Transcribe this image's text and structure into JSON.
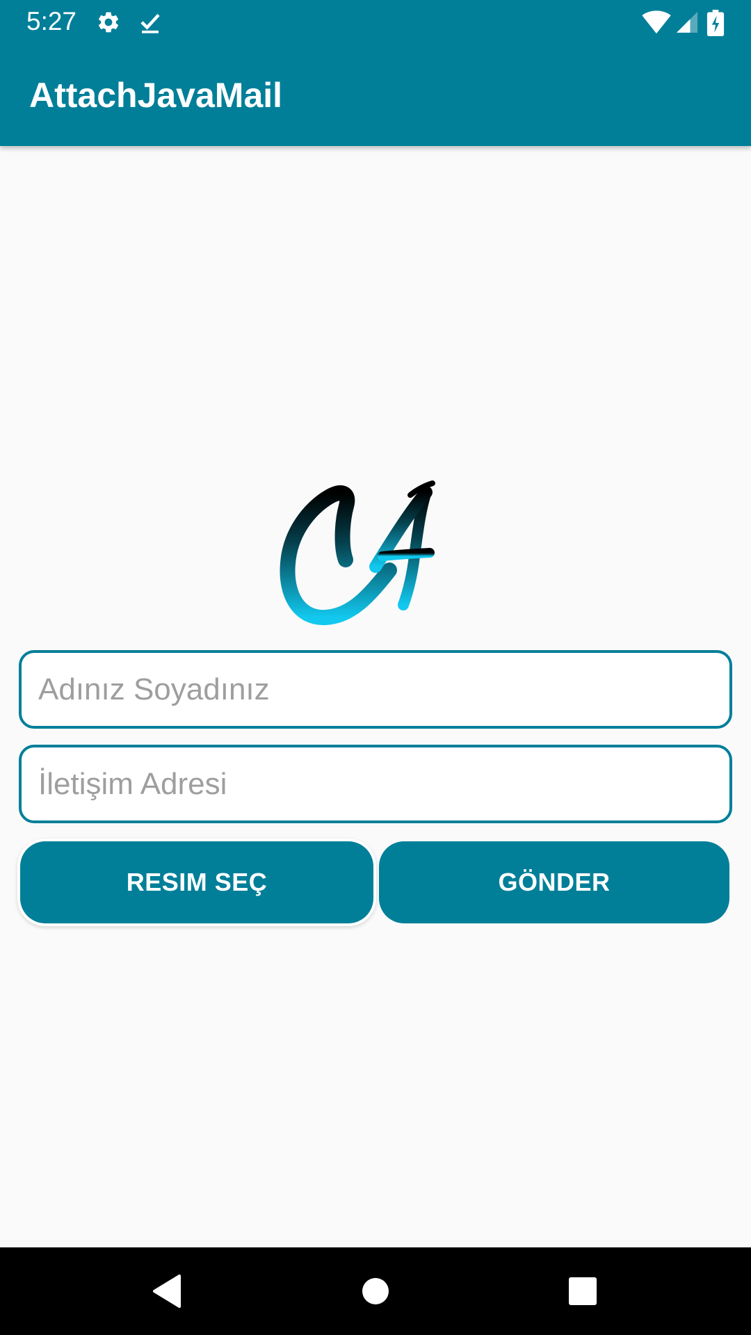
{
  "status_bar": {
    "time": "5:27",
    "icons": [
      "gear-icon",
      "check-download-icon",
      "wifi-icon",
      "signal-icon",
      "battery-charging-icon"
    ]
  },
  "app_bar": {
    "title": "AttachJavaMail"
  },
  "logo": {
    "text": "CA",
    "gradient_top": "#000000",
    "gradient_bottom": "#12c8ee"
  },
  "form": {
    "name_placeholder": "Adınız Soyadınız",
    "contact_placeholder": "İletişim Adresi",
    "select_image_label": "RESIM SEÇ",
    "send_label": "GÖNDER"
  },
  "nav_bar": {
    "icons": [
      "back-icon",
      "home-icon",
      "recents-icon"
    ]
  },
  "colors": {
    "primary": "#017f99",
    "background": "#fafafa",
    "placeholder": "#9e9e9e"
  }
}
